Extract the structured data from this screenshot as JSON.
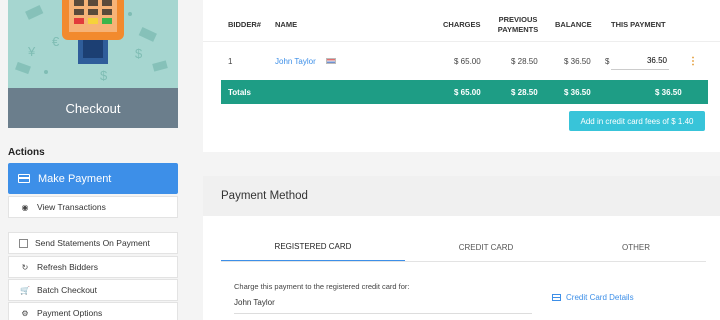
{
  "hero": {
    "label": "Checkout",
    "bg_color": "#a6d6d0"
  },
  "actions": {
    "title": "Actions",
    "make_payment": "Make Payment",
    "view_transactions": "View Transactions",
    "send_statements": "Send Statements On Payment",
    "refresh_bidders": "Refresh Bidders",
    "batch_checkout": "Batch Checkout",
    "payment_options": "Payment Options"
  },
  "table": {
    "headers": {
      "bidder": "BIDDER#",
      "name": "NAME",
      "charges": "CHARGES",
      "previous": "PREVIOUS PAYMENTS",
      "balance": "BALANCE",
      "this_payment": "THIS PAYMENT"
    },
    "row": {
      "bidder": "1",
      "name": "John Taylor",
      "charges": "$ 65.00",
      "previous": "$ 28.50",
      "balance": "$ 36.50",
      "currency": "$",
      "this_payment": "36.50"
    },
    "totals": {
      "label": "Totals",
      "charges": "$ 65.00",
      "previous": "$ 28.50",
      "balance": "$ 36.50",
      "this_payment": "$ 36.50"
    },
    "fee_button": "Add in credit card fees of $ 1.40"
  },
  "payment_method": {
    "title": "Payment Method",
    "tabs": [
      "REGISTERED CARD",
      "CREDIT CARD",
      "OTHER"
    ],
    "note": "Charge this payment to the registered credit card for:",
    "name": "John Taylor",
    "details_link": "Credit Card Details"
  },
  "colors": {
    "accent": "#3d8fe8",
    "totals_bar": "#1e9d85",
    "fee_button": "#38c4d9"
  }
}
